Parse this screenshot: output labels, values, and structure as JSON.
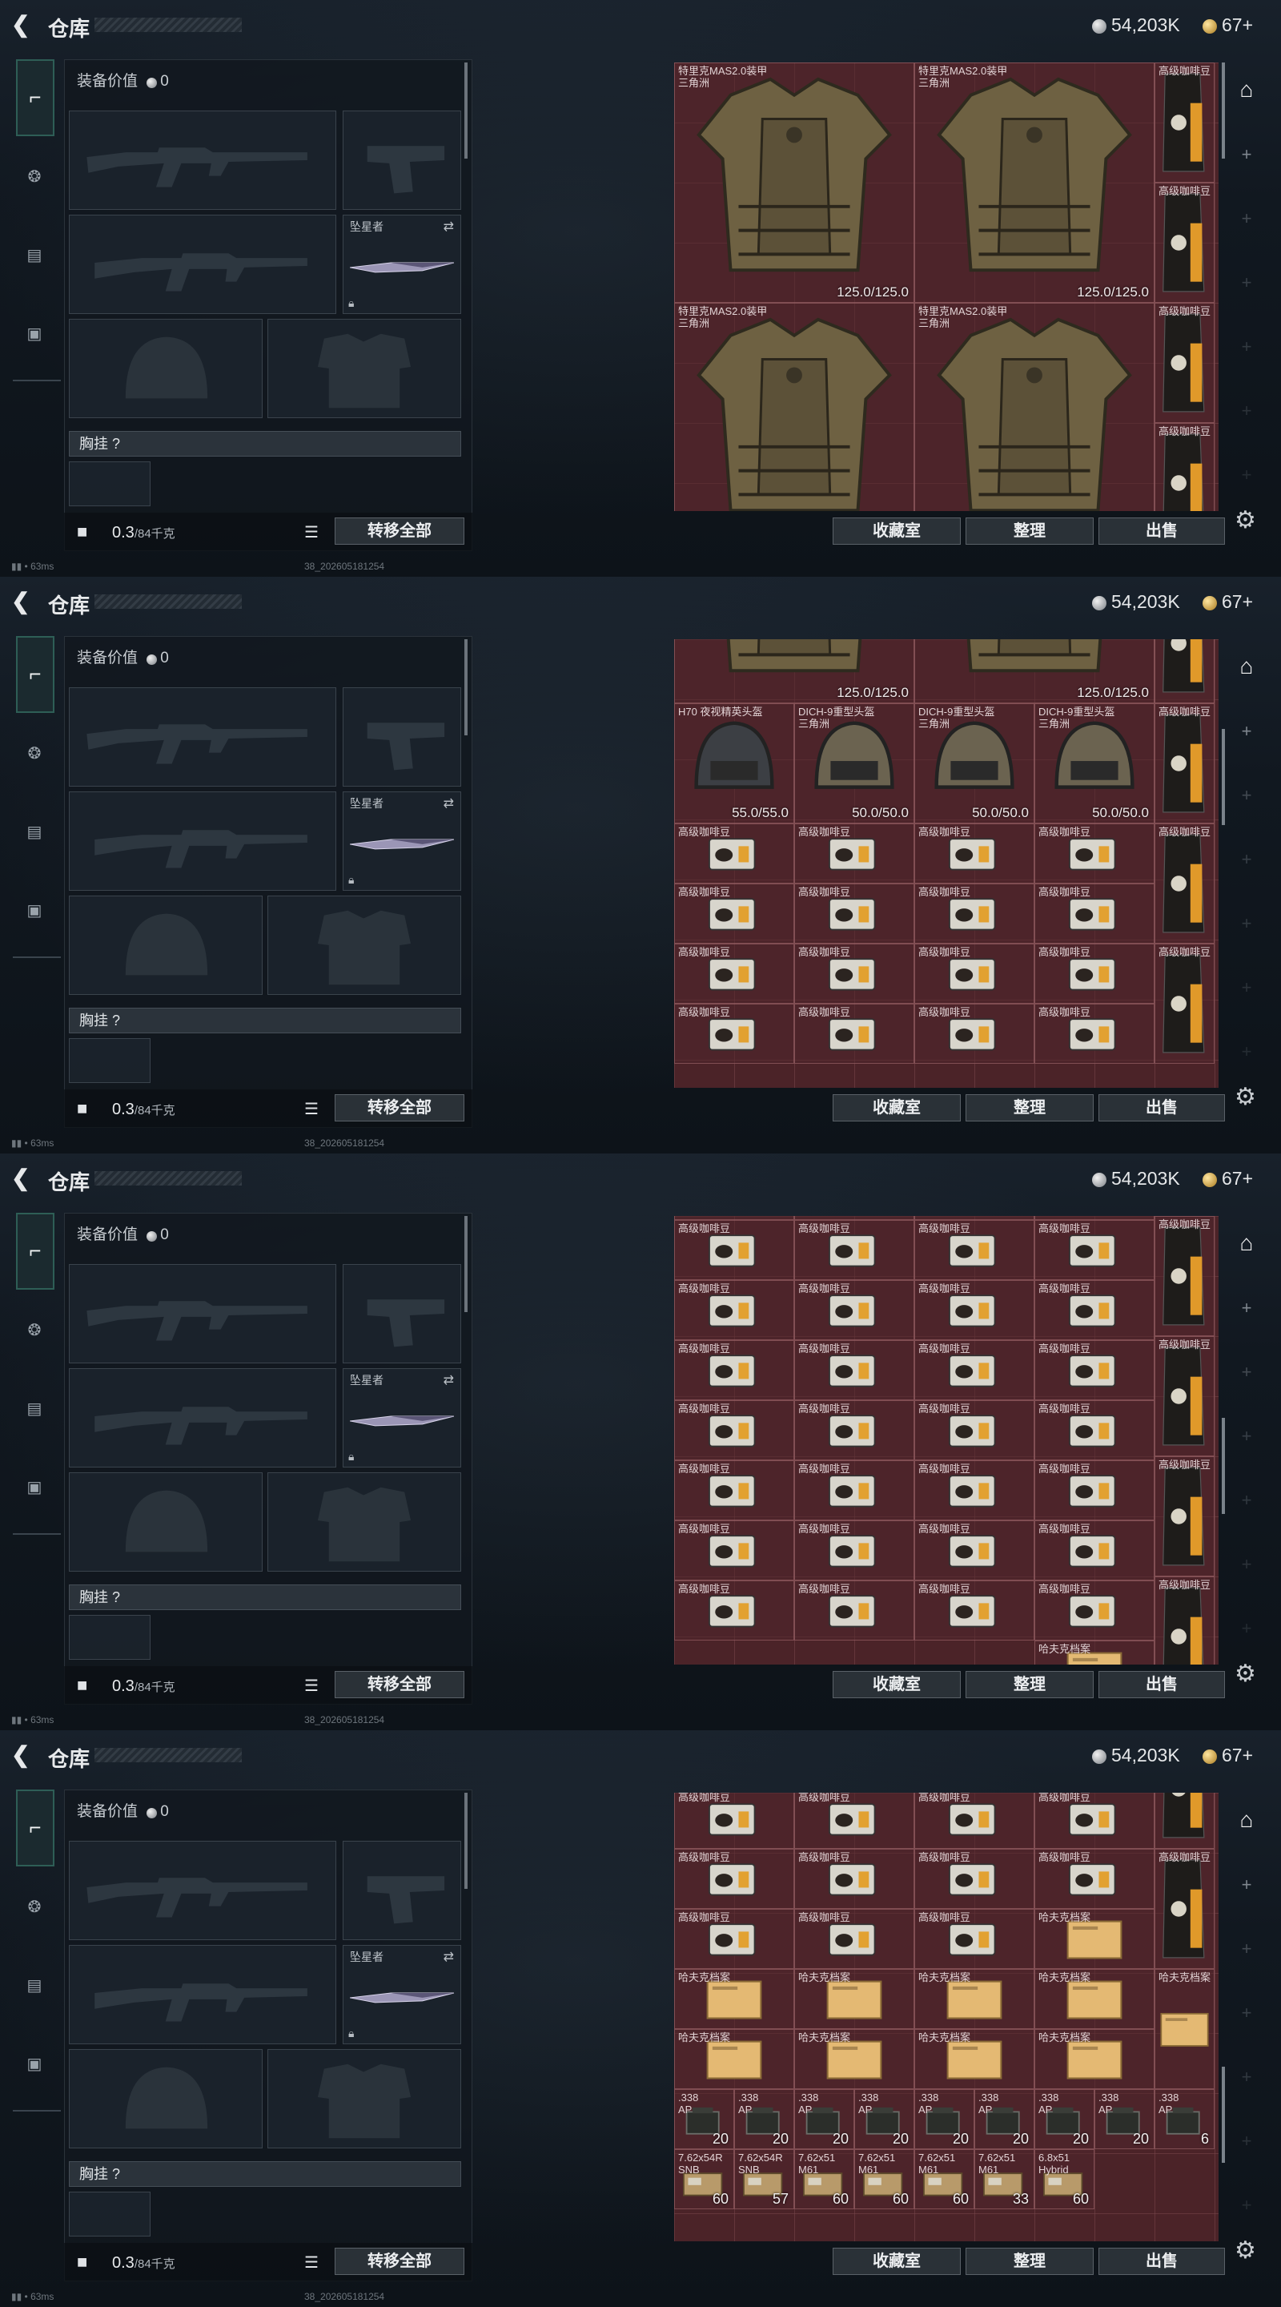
{
  "header": {
    "title": "仓库",
    "silver": "54,203K",
    "gold": "67+"
  },
  "left": {
    "equip_value_label": "装备价值",
    "equip_value": "0",
    "melee_label": "坠星者",
    "chest_rig_label": "胸挂 ?",
    "weight": "0.3",
    "weight_unit": "/84千克",
    "transfer_all": "转移全部"
  },
  "actions": {
    "collection": "收藏室",
    "organize": "整理",
    "sell": "出售"
  },
  "status": {
    "ping": "63ms",
    "build": "38_202605181254"
  },
  "icons": {
    "back": "back-arrow-icon",
    "weapons_tab": "pistol-icon",
    "helmet_tab": "helmet-icon",
    "clipboard_tab": "clipboard-icon",
    "briefcase_tab": "briefcase-icon",
    "lock": "lock-icon",
    "list": "list-icon",
    "swap": "swap-icon",
    "gear": "gear-icon",
    "garage": "garage-icon",
    "plus": "plus-icon"
  },
  "items": {
    "vest_name": "特里克MAS2.0装甲",
    "vest_sub": "三角洲",
    "vest_dur": "125.0/125.0",
    "coffee": "高级咖啡豆",
    "h70": "H70 夜视精英头盔",
    "h70_dur": "55.0/55.0",
    "dich": "DICH-9重型头盔",
    "dich_sub": "三角洲",
    "dich_dur": "50.0/50.0",
    "archive": "哈夫克档案",
    "ammo338": ".338",
    "ammo338_sub": "AP",
    "ammo338_qty": "20",
    "ammo338_last": "6",
    "ammo762r": "7.62x54R",
    "ammo762r_sub": "SNB",
    "ammo762": "7.62x51",
    "ammo762_sub": "M61",
    "ammo68": "6.8x51",
    "ammo68_sub": "Hybrid",
    "q60": "60",
    "q57": "57",
    "q33": "33"
  }
}
